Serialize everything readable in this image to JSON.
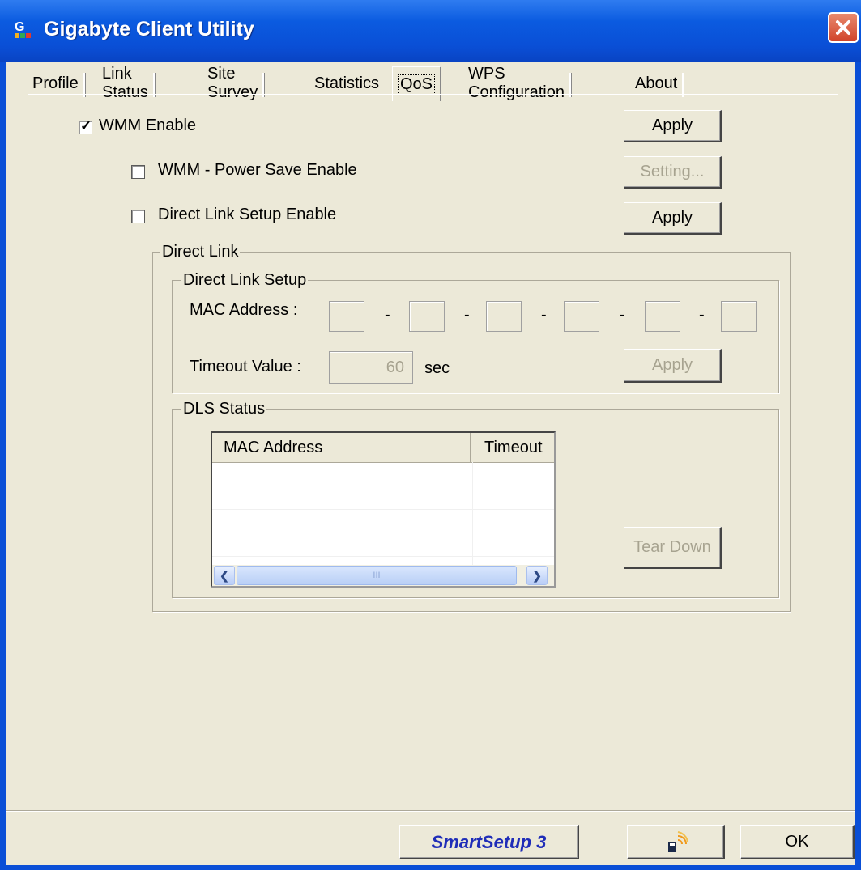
{
  "window": {
    "title": "Gigabyte Client Utility"
  },
  "tabs": [
    {
      "label": "Profile"
    },
    {
      "label": "Link Status"
    },
    {
      "label": "Site Survey"
    },
    {
      "label": "Statistics"
    },
    {
      "label": "QoS",
      "active": true
    },
    {
      "label": "WPS Configuration"
    },
    {
      "label": "About"
    }
  ],
  "qos": {
    "wmm_enable": {
      "label": "WMM Enable",
      "checked": true,
      "apply_label": "Apply"
    },
    "wmm_power_save": {
      "label": "WMM - Power Save Enable",
      "checked": false,
      "setting_label": "Setting..."
    },
    "dls_enable": {
      "label": "Direct Link Setup Enable",
      "checked": false,
      "apply_label": "Apply"
    }
  },
  "direct_link": {
    "group_title": "Direct Link",
    "setup": {
      "group_title": "Direct Link Setup",
      "mac_label": "MAC Address :",
      "mac_sep": "-",
      "timeout_label": "Timeout Value :",
      "timeout_value": "60",
      "timeout_unit": "sec",
      "apply_label": "Apply"
    },
    "status": {
      "group_title": "DLS Status",
      "columns": [
        "MAC Address",
        "Timeout"
      ],
      "tear_down_label": "Tear Down",
      "scroll_grip": "III"
    }
  },
  "footer": {
    "smartsetup_label": "SmartSetup 3",
    "ok_label": "OK"
  },
  "colors": {
    "title_bar": "#0a4fd6",
    "dialog_bg": "#ece9d8",
    "brand_text": "#1f2db8"
  }
}
